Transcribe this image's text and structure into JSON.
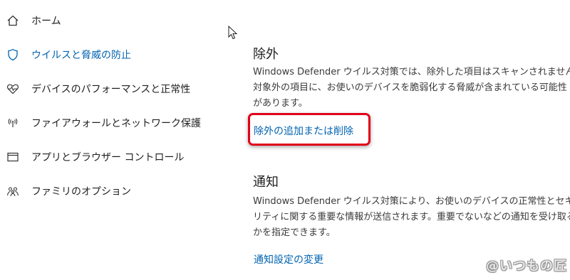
{
  "sidebar": {
    "items": [
      {
        "label": "ホーム",
        "icon": "home-icon"
      },
      {
        "label": "ウイルスと脅威の防止",
        "icon": "shield-icon",
        "active": true
      },
      {
        "label": "デバイスのパフォーマンスと正常性",
        "icon": "heart-pulse-icon"
      },
      {
        "label": "ファイアウォールとネットワーク保護",
        "icon": "wifi-antenna-icon"
      },
      {
        "label": "アプリとブラウザー コントロール",
        "icon": "app-window-icon"
      },
      {
        "label": "ファミリのオプション",
        "icon": "family-icon"
      }
    ]
  },
  "exclusions": {
    "title": "除外",
    "description_lines": [
      "Windows Defender ウイルス対策では、除外した項目はスキャンされません。",
      "対象外の項目に、お使いのデバイスを脆弱化する脅威が含まれている可能性",
      "があります。"
    ],
    "link": "除外の追加または削除"
  },
  "notifications": {
    "title": "通知",
    "description_lines": [
      "Windows Defender ウイルス対策により、お使いのデバイスの正常性とセキュ",
      "リティに関する重要な情報が送信されます。重要でないなどの通知を受け取る",
      "かを指定できます。"
    ],
    "link": "通知設定の変更"
  },
  "watermark": "@いつもの匠",
  "colors": {
    "accent": "#0063b1",
    "highlight": "#e2001a"
  }
}
